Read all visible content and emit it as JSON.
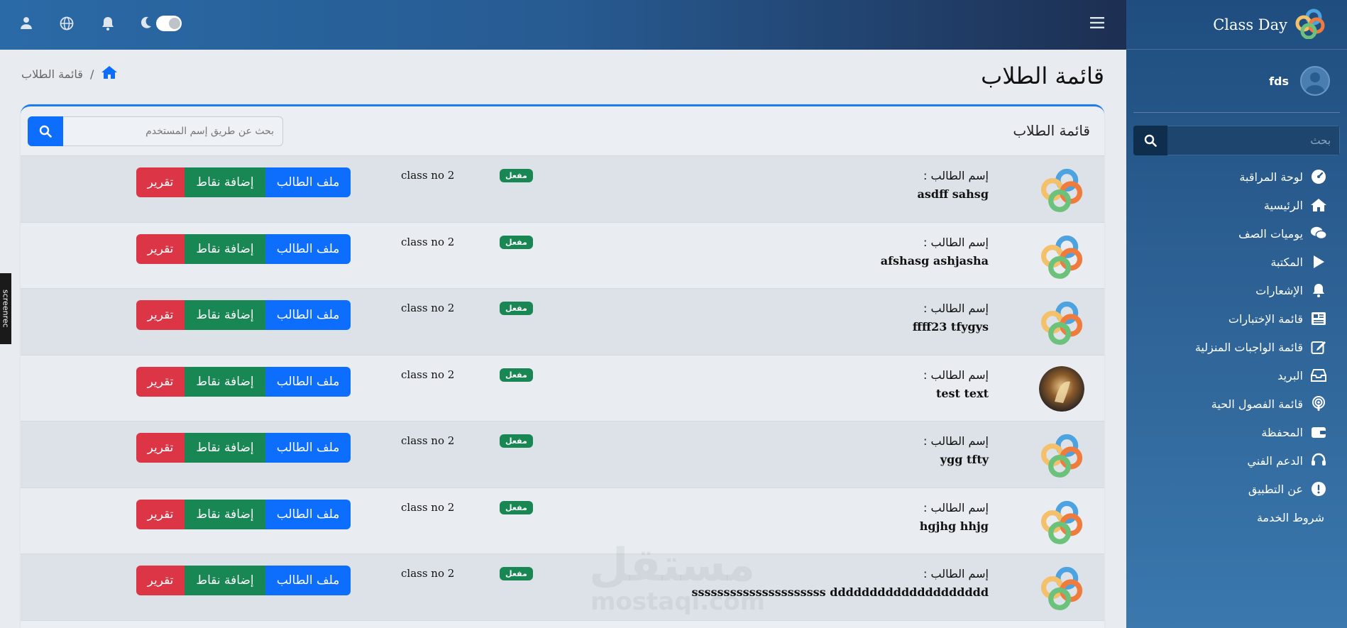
{
  "brand": {
    "name": "Class Day"
  },
  "profile": {
    "name": "fds"
  },
  "sidebar": {
    "search_placeholder": "بحث",
    "items": [
      {
        "label": "لوحة المراقبة",
        "icon": "dashboard-icon"
      },
      {
        "label": "الرئيسية",
        "icon": "home-icon"
      },
      {
        "label": "يوميات الصف",
        "icon": "comments-icon"
      },
      {
        "label": "المكتبة",
        "icon": "play-icon"
      },
      {
        "label": "الإشعارات",
        "icon": "bell-icon"
      },
      {
        "label": "قائمة الإختبارات",
        "icon": "newspaper-icon"
      },
      {
        "label": "قائمة الواجبات المنزلية",
        "icon": "edit-icon"
      },
      {
        "label": "البريد",
        "icon": "inbox-icon"
      },
      {
        "label": "قائمة الفصول الحية",
        "icon": "podcast-icon"
      },
      {
        "label": "المحفظة",
        "icon": "wallet-icon"
      },
      {
        "label": "الدعم الفني",
        "icon": "headset-icon"
      },
      {
        "label": "عن التطبيق",
        "icon": "info-icon"
      },
      {
        "label": "شروط الخدمة",
        "icon": ""
      }
    ]
  },
  "page": {
    "title": "قائمة الطلاب",
    "breadcrumb": "قائمة الطلاب"
  },
  "card": {
    "title": "قائمة الطلاب",
    "search_placeholder": "بحث عن طريق إسم المستخدم"
  },
  "students": {
    "label": "إسم الطالب :",
    "badge": "مفعل",
    "buttons": {
      "profile": "ملف الطالب",
      "points": "إضافة نقاط",
      "report": "تقرير"
    },
    "rows": [
      {
        "name": "asdff sahsg",
        "class": "class no 2",
        "avatar": "logo"
      },
      {
        "name": "afshasg ashjasha",
        "class": "class no 2",
        "avatar": "logo"
      },
      {
        "name": "ffff23 tfygys",
        "class": "class no 2",
        "avatar": "logo"
      },
      {
        "name": "test text",
        "class": "class no 2",
        "avatar": "photo"
      },
      {
        "name": "ygg tfty",
        "class": "class no 2",
        "avatar": "logo"
      },
      {
        "name": "hgjhg hhjg",
        "class": "class no 2",
        "avatar": "logo"
      },
      {
        "name": "sssssssssssssssssssss dddddddddddddddddddd",
        "class": "class no 2",
        "avatar": "logo"
      }
    ]
  },
  "overlay": {
    "recorder": "screenrec",
    "watermark": "مستقل",
    "watermark_latin": "mostaql.com"
  },
  "colors": {
    "primary": "#0d6efd",
    "success": "#198754",
    "danger": "#dc3545",
    "sidebar": "#2c5f92"
  }
}
